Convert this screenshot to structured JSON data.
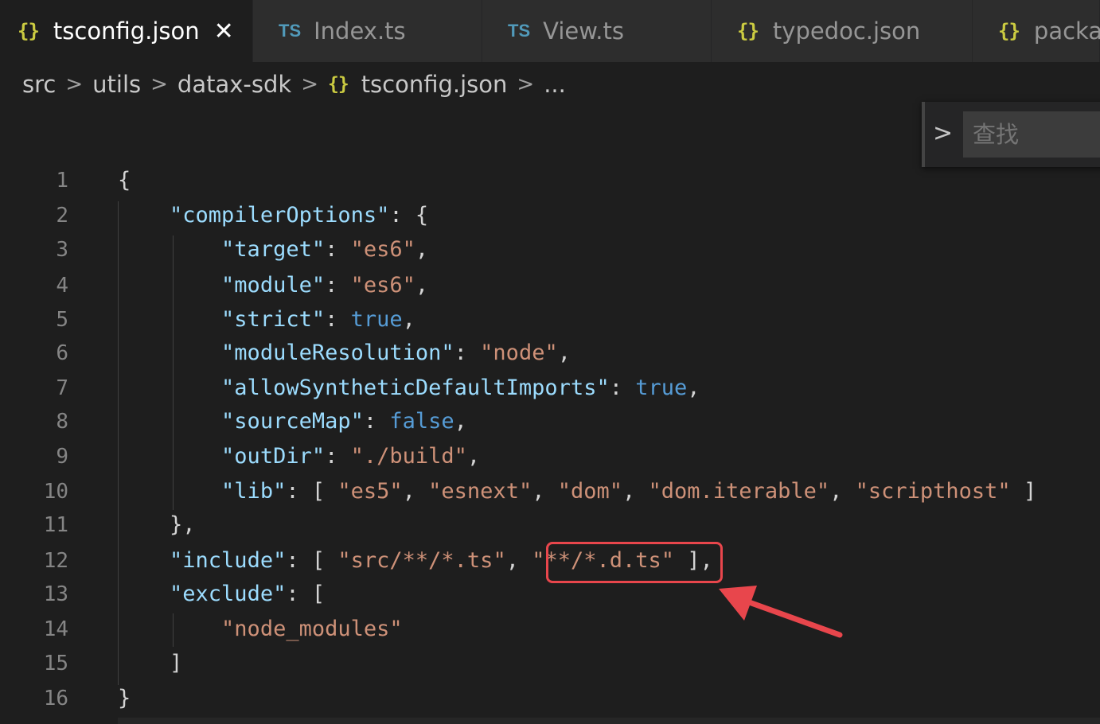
{
  "tabs": [
    {
      "icon": "{}",
      "label": "tsconfig.json",
      "close": "✕",
      "active": true
    },
    {
      "icon": "TS",
      "label": "Index.ts"
    },
    {
      "icon": "TS",
      "label": "View.ts"
    },
    {
      "icon": "{}",
      "label": "typedoc.json"
    },
    {
      "icon": "{}",
      "label": "packa"
    }
  ],
  "breadcrumb": {
    "items": [
      "src",
      "utils",
      "datax-sdk",
      "tsconfig.json",
      "..."
    ],
    "separator": ">",
    "file_icon": "{}"
  },
  "find": {
    "toggle": ">",
    "placeholder": "查找"
  },
  "line_numbers": [
    "1",
    "2",
    "3",
    "4",
    "5",
    "6",
    "7",
    "8",
    "9",
    "10",
    "11",
    "12",
    "13",
    "14",
    "15",
    "16"
  ],
  "code": {
    "l1": "{",
    "l2_key": "\"compilerOptions\"",
    "l2_rest": ": {",
    "l3_key": "\"target\"",
    "l3_val": "\"es6\"",
    "l4_key": "\"module\"",
    "l4_val": "\"es6\"",
    "l5_key": "\"strict\"",
    "l5_val": "true",
    "l6_key": "\"moduleResolution\"",
    "l6_val": "\"node\"",
    "l7_key": "\"allowSyntheticDefaultImports\"",
    "l7_val": "true",
    "l8_key": "\"sourceMap\"",
    "l8_val": "false",
    "l9_key": "\"outDir\"",
    "l9_val": "\"./build\"",
    "l10_key": "\"lib\"",
    "l10_v1": "\"es5\"",
    "l10_v2": "\"esnext\"",
    "l10_v3": "\"dom\"",
    "l10_v4": "\"dom.iterable\"",
    "l10_v5": "\"scripthost\"",
    "l11": "},",
    "l12_key": "\"include\"",
    "l12_v1": "\"src/**/*.ts\"",
    "l12_v2": "\"**/*.d.ts\"",
    "l13_key": "\"exclude\"",
    "l14_val": "\"node_modules\"",
    "l15": "]",
    "l16": "}"
  },
  "colors": {
    "background": "#1e1e1e",
    "json_key": "#9cdcfe",
    "string": "#ce9178",
    "keyword": "#569cd6",
    "annotation": "#e8464c"
  }
}
